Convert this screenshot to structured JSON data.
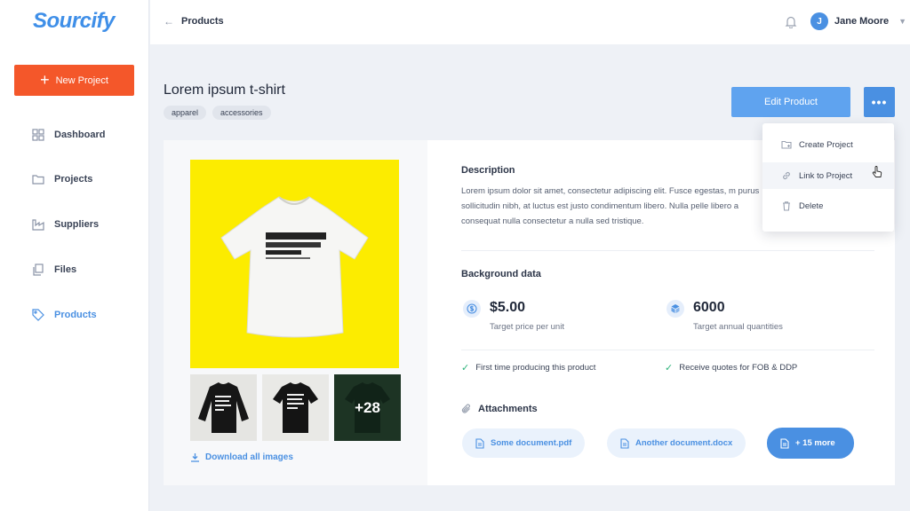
{
  "app": {
    "logo": "Sourcify"
  },
  "sidebar": {
    "new_project_label": "New Project",
    "items": [
      {
        "label": "Dashboard",
        "icon": "grid-icon"
      },
      {
        "label": "Projects",
        "icon": "folder-icon"
      },
      {
        "label": "Suppliers",
        "icon": "factory-icon"
      },
      {
        "label": "Files",
        "icon": "files-icon"
      },
      {
        "label": "Products",
        "icon": "tag-icon",
        "active": true
      }
    ]
  },
  "topbar": {
    "breadcrumb": "Products",
    "user": {
      "initial": "J",
      "name": "Jane Moore"
    }
  },
  "product": {
    "title": "Lorem ipsum t-shirt",
    "tags": [
      "apparel",
      "accessories"
    ],
    "edit_label": "Edit Product",
    "more_label": "•••",
    "images": {
      "more_count": "+28",
      "download_label": "Download all images"
    },
    "description": {
      "title": "Description",
      "text": "Lorem ipsum dolor sit amet, consectetur adipiscing elit. Fusce egestas, m purus sollicitudin nibh, at luctus est justo condimentum libero. Nulla pelle libero a consequat nulla consectetur a nulla sed tristique."
    },
    "background": {
      "title": "Background data",
      "price_value": "$5.00",
      "price_label": "Target price per unit",
      "quantity_value": "6000",
      "quantity_label": "Target annual quantities",
      "check1": "First time producing this product",
      "check2": "Receive quotes for FOB & DDP"
    },
    "attachments": {
      "title": "Attachments",
      "files": [
        "Some document.pdf",
        "Another document.docx"
      ],
      "more_label": "+ 15 more"
    }
  },
  "dropdown": {
    "items": [
      {
        "label": "Create Project",
        "icon": "add-folder-icon"
      },
      {
        "label": "Link to Project",
        "icon": "link-icon"
      },
      {
        "label": "Delete",
        "icon": "trash-icon"
      }
    ]
  },
  "colors": {
    "accent": "#4a90e2",
    "primary_button": "#f4572a",
    "check": "#2fb47c",
    "image_background": "#fcec00"
  }
}
